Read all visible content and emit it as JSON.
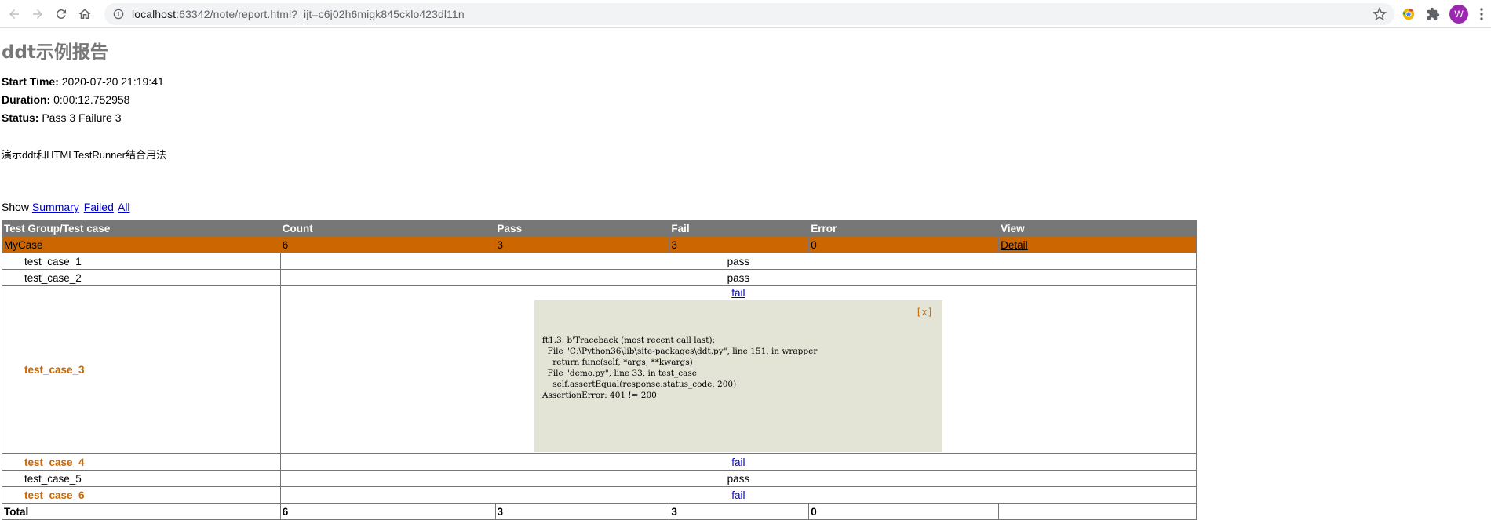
{
  "browser": {
    "url_host": "localhost",
    "url_rest": ":63342/note/report.html?_ijt=c6j02h6migk845cklo423dl11n",
    "avatar_letter": "W"
  },
  "report": {
    "title": "ddt示例报告",
    "start_time_label": "Start Time:",
    "start_time": "2020-07-20 21:19:41",
    "duration_label": "Duration:",
    "duration": "0:00:12.752958",
    "status_label": "Status:",
    "status": "Pass 3 Failure 3",
    "description": "演示ddt和HTMLTestRunner结合用法",
    "show_label": "Show",
    "show_summary": "Summary",
    "show_failed": "Failed",
    "show_all": "All"
  },
  "table": {
    "headers": [
      "Test Group/Test case",
      "Count",
      "Pass",
      "Fail",
      "Error",
      "View"
    ],
    "group": {
      "name": "MyCase",
      "count": "6",
      "pass": "3",
      "fail": "3",
      "error": "0",
      "view": "Detail"
    },
    "cases": [
      {
        "name": "test_case_1",
        "status": "pass"
      },
      {
        "name": "test_case_2",
        "status": "pass"
      },
      {
        "name": "test_case_3",
        "status": "fail"
      },
      {
        "name": "test_case_4",
        "status": "fail"
      },
      {
        "name": "test_case_5",
        "status": "pass"
      },
      {
        "name": "test_case_6",
        "status": "fail"
      }
    ],
    "traceback": {
      "close": "[x]",
      "text": "ft1.3: b'Traceback (most recent call last):\n  File \"C:\\Python36\\lib\\site-packages\\ddt.py\", line 151, in wrapper\n    return func(self, *args, **kwargs)\n  File \"demo.py\", line 33, in test_case\n    self.assertEqual(response.status_code, 200)\nAssertionError: 401 != 200"
    },
    "total": {
      "label": "Total",
      "count": "6",
      "pass": "3",
      "fail": "3",
      "error": "0",
      "view": ""
    }
  }
}
